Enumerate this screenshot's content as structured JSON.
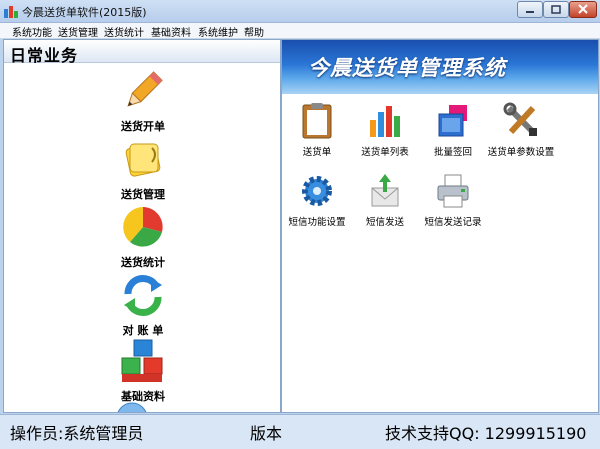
{
  "window": {
    "title": "今晨送货单软件(2015版)"
  },
  "menu": [
    "系统功能",
    "送货管理",
    "送货统计",
    "基础资料",
    "系统维护",
    "帮助"
  ],
  "left_panel": {
    "title": "日常业务",
    "items": [
      {
        "label": "送货开单",
        "icon": "pencil-icon"
      },
      {
        "label": "送货管理",
        "icon": "notes-icon"
      },
      {
        "label": "送货统计",
        "icon": "pie-chart-icon"
      },
      {
        "label": "对 账 单",
        "icon": "refresh-icon"
      },
      {
        "label": "基础资料",
        "icon": "blocks-icon"
      }
    ]
  },
  "right_panel": {
    "banner_title": "今晨送货单管理系统",
    "functions": [
      {
        "label": "送货单",
        "icon": "clipboard-icon"
      },
      {
        "label": "送货单列表",
        "icon": "bar-chart-icon"
      },
      {
        "label": "批量签回",
        "icon": "windows-icon"
      },
      {
        "label": "送货单参数设置",
        "icon": "tools-icon"
      },
      {
        "label": "短信功能设置",
        "icon": "gear-icon"
      },
      {
        "label": "短信发送",
        "icon": "send-icon"
      },
      {
        "label": "短信发送记录",
        "icon": "printer-icon"
      }
    ]
  },
  "status": {
    "operator": "操作员:系统管理员",
    "version": "版本",
    "support": "技术支持QQ: 1299915190"
  },
  "colors": {
    "banner": "#2a76d6",
    "panel_border": "#8aa6c9",
    "status_bg": "#d9e6f5"
  }
}
